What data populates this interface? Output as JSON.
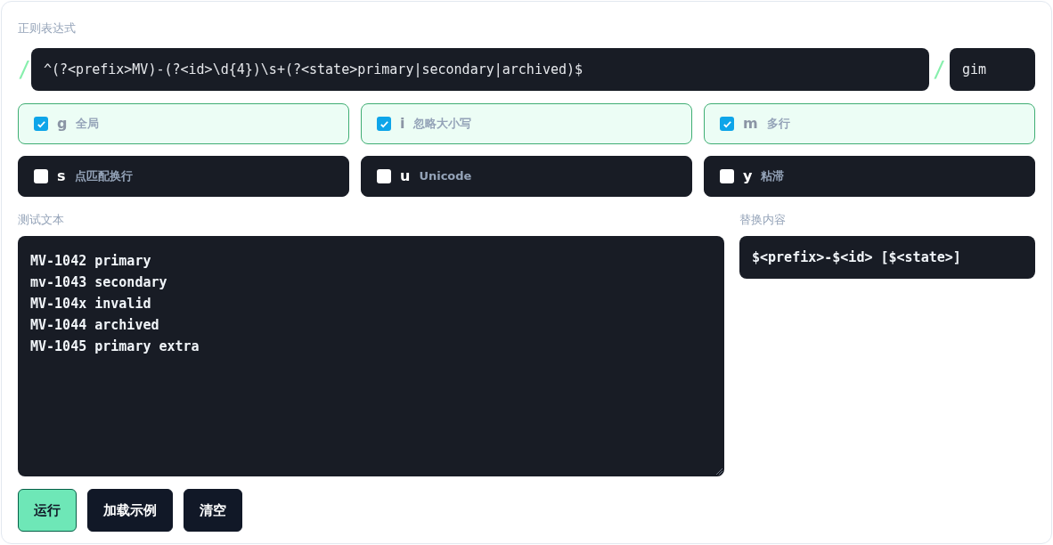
{
  "regex_label": "正则表达式",
  "delimiter_open": "/",
  "pattern": "^(?<prefix>MV)-(?<id>\\d{4})\\s+(?<state>primary|secondary|archived)$",
  "delimiter_close": "/",
  "flags_value": "gim",
  "flags": [
    {
      "letter": "g",
      "label": "全局",
      "checked": true
    },
    {
      "letter": "i",
      "label": "忽略大小写",
      "checked": true
    },
    {
      "letter": "m",
      "label": "多行",
      "checked": true
    },
    {
      "letter": "s",
      "label": "点匹配换行",
      "checked": false
    },
    {
      "letter": "u",
      "label": "Unicode",
      "checked": false
    },
    {
      "letter": "y",
      "label": "粘滞",
      "checked": false
    }
  ],
  "test_label": "测试文本",
  "test_lines": [
    "MV-1042 primary",
    "mv-1043 secondary",
    "MV-104x invalid",
    "MV-1044 archived",
    "MV-1045 primary extra"
  ],
  "replace_label": "替换内容",
  "replacement": "$<prefix>-$<id> [$<state>]",
  "buttons": [
    {
      "label": "运行",
      "kind": "primary"
    },
    {
      "label": "加载示例",
      "kind": "secondary"
    },
    {
      "label": "清空",
      "kind": "secondary"
    }
  ]
}
